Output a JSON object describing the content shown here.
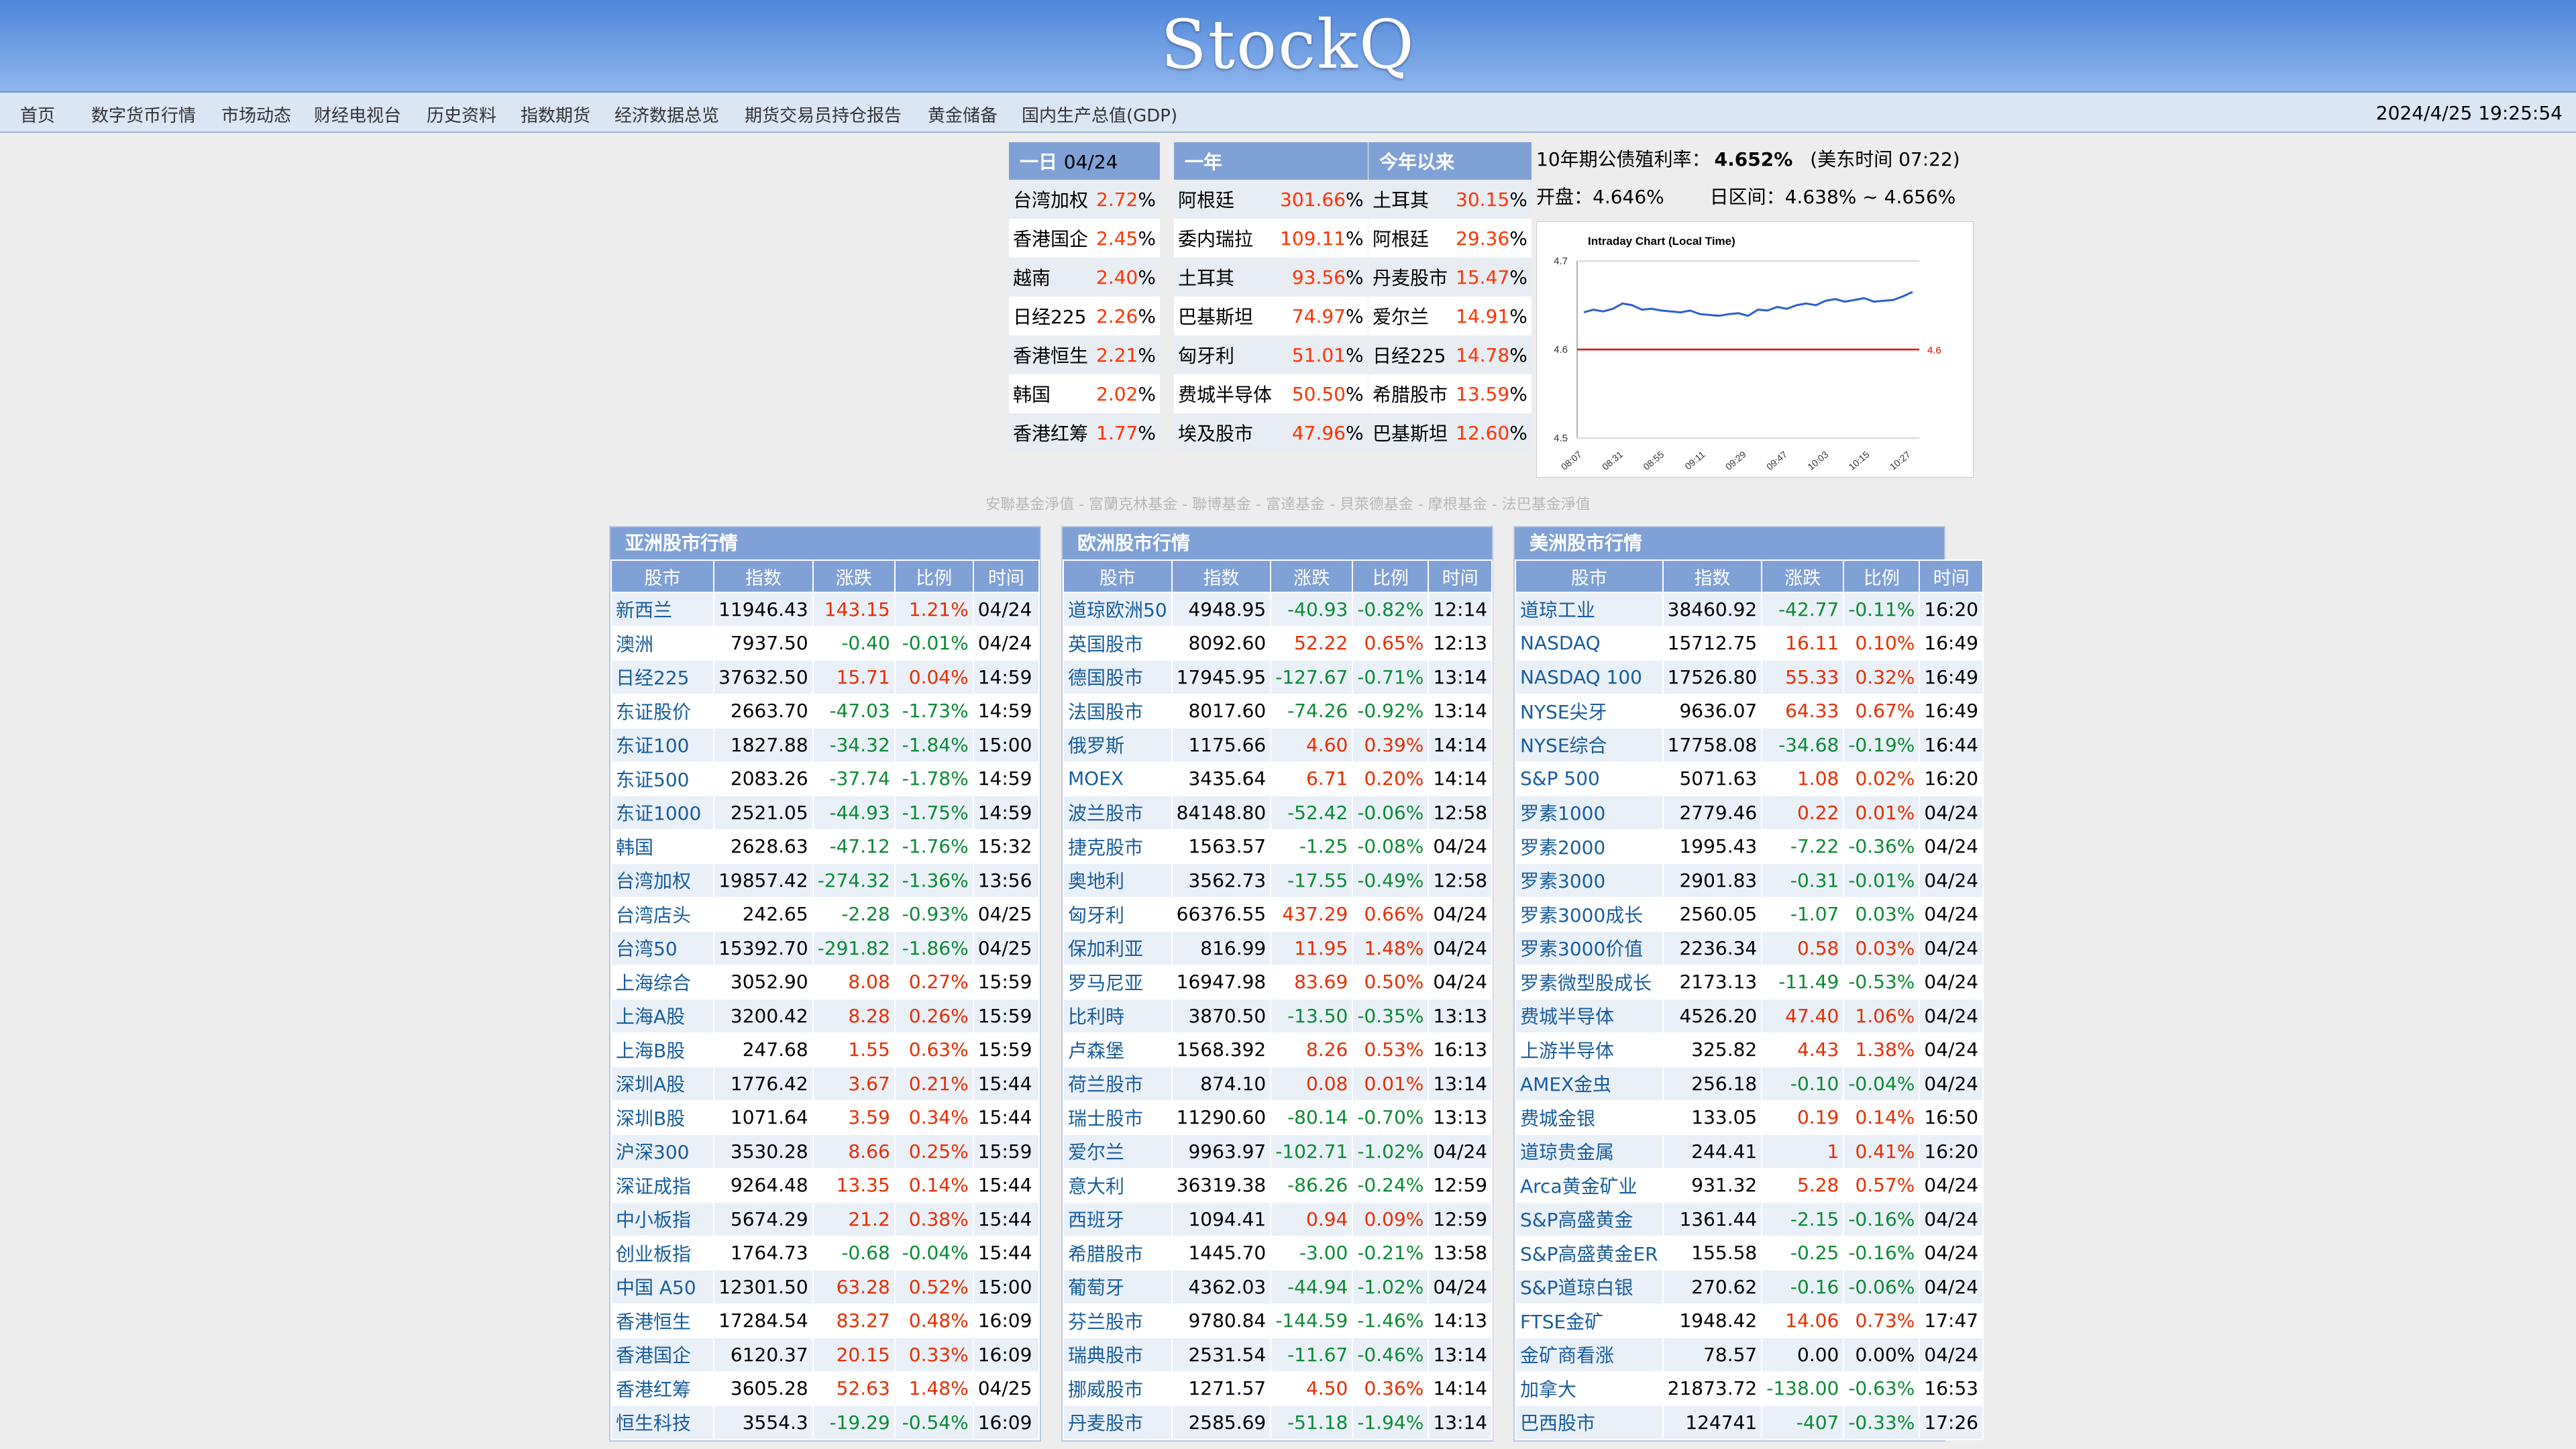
{
  "brand": "StockQ",
  "nav": [
    "首页",
    "数字货币行情",
    "市场动态",
    "财经电视台",
    "历史资料",
    "指数期货",
    "经济数据总览",
    "期货交易员持仓报告",
    "黄金储备",
    "国内生产总值(GDP)"
  ],
  "datetime": "2024/4/25  19:25:54",
  "top": {
    "day": {
      "title": "一日 ",
      "date": "04/24",
      "rows": [
        [
          "台湾加权",
          "2.72"
        ],
        [
          "香港国企",
          "2.45"
        ],
        [
          "越南",
          "2.40"
        ],
        [
          "日经225",
          "2.26"
        ],
        [
          "香港恒生",
          "2.21"
        ],
        [
          "韩国",
          "2.02"
        ],
        [
          "香港红筹",
          "1.77"
        ]
      ]
    },
    "year": {
      "title": "一年",
      "rows": [
        [
          "阿根廷",
          "301.66"
        ],
        [
          "委内瑞拉",
          "109.11"
        ],
        [
          "土耳其",
          "93.56"
        ],
        [
          "巴基斯坦",
          "74.97"
        ],
        [
          "匈牙利",
          "51.01"
        ],
        [
          "费城半导体",
          "50.50"
        ],
        [
          "埃及股市",
          "47.96"
        ]
      ]
    },
    "ytd": {
      "title": "今年以来",
      "rows": [
        [
          "土耳其",
          "30.15"
        ],
        [
          "阿根廷",
          "29.36"
        ],
        [
          "丹麦股市",
          "15.47"
        ],
        [
          "爱尔兰",
          "14.91"
        ],
        [
          "日经225",
          "14.78"
        ],
        [
          "希腊股市",
          "13.59"
        ],
        [
          "巴基斯坦",
          "12.60"
        ]
      ]
    }
  },
  "bond": {
    "label": "10年期公债殖利率：",
    "value": "4.652%",
    "time": "(美东时间 07:22)",
    "open_label": "开盘：",
    "open": "4.646%",
    "range_label": "日区间：",
    "range": "4.638% ~ 4.656%"
  },
  "chart_data": {
    "type": "line",
    "title": "Intraday Chart (Local Time)",
    "x": [
      "08:07",
      "08:31",
      "08:55",
      "09:11",
      "09:29",
      "09:47",
      "10:03",
      "10:15",
      "10:27"
    ],
    "ylim": [
      4.5,
      4.7
    ],
    "yticks": [
      "4.5",
      "4.6",
      "4.7"
    ],
    "reference": {
      "value": 4.6,
      "label": "4.6",
      "color": "#e60000"
    },
    "series": [
      {
        "color": "#2b5fce",
        "values": [
          4.642,
          4.645,
          4.643,
          4.646,
          4.652,
          4.65,
          4.645,
          4.646,
          4.644,
          4.643,
          4.642,
          4.644,
          4.64,
          4.639,
          4.638,
          4.64,
          4.641,
          4.638,
          4.645,
          4.644,
          4.648,
          4.646,
          4.65,
          4.652,
          4.65,
          4.655,
          4.657,
          4.654,
          4.656,
          4.658,
          4.654,
          4.655,
          4.656,
          4.66,
          4.665
        ]
      }
    ]
  },
  "funds_text": "安聯基金淨值 - 富蘭克林基金 - 聯博基金 - 富達基金 - 貝萊德基金 - 摩根基金 - 法巴基金淨值",
  "columns": [
    "股市",
    "指数",
    "涨跌",
    "比例",
    "时间"
  ],
  "asia": {
    "title": "亚洲股市行情",
    "rows": [
      [
        "新西兰",
        "11946.43",
        "143.15",
        "1.21%",
        "04/24"
      ],
      [
        "澳洲",
        "7937.50",
        "-0.40",
        "-0.01%",
        "04/24"
      ],
      [
        "日经225",
        "37632.50",
        "15.71",
        "0.04%",
        "14:59"
      ],
      [
        "东证股价",
        "2663.70",
        "-47.03",
        "-1.73%",
        "14:59"
      ],
      [
        "东证100",
        "1827.88",
        "-34.32",
        "-1.84%",
        "15:00"
      ],
      [
        "东证500",
        "2083.26",
        "-37.74",
        "-1.78%",
        "14:59"
      ],
      [
        "东证1000",
        "2521.05",
        "-44.93",
        "-1.75%",
        "14:59"
      ],
      [
        "韩国",
        "2628.63",
        "-47.12",
        "-1.76%",
        "15:32"
      ],
      [
        "台湾加权",
        "19857.42",
        "-274.32",
        "-1.36%",
        "13:56"
      ],
      [
        "台湾店头",
        "242.65",
        "-2.28",
        "-0.93%",
        "04/25"
      ],
      [
        "台湾50",
        "15392.70",
        "-291.82",
        "-1.86%",
        "04/25"
      ],
      [
        "上海综合",
        "3052.90",
        "8.08",
        "0.27%",
        "15:59"
      ],
      [
        "上海A股",
        "3200.42",
        "8.28",
        "0.26%",
        "15:59"
      ],
      [
        "上海B股",
        "247.68",
        "1.55",
        "0.63%",
        "15:59"
      ],
      [
        "深圳A股",
        "1776.42",
        "3.67",
        "0.21%",
        "15:44"
      ],
      [
        "深圳B股",
        "1071.64",
        "3.59",
        "0.34%",
        "15:44"
      ],
      [
        "沪深300",
        "3530.28",
        "8.66",
        "0.25%",
        "15:59"
      ],
      [
        "深证成指",
        "9264.48",
        "13.35",
        "0.14%",
        "15:44"
      ],
      [
        "中小板指",
        "5674.29",
        "21.2",
        "0.38%",
        "15:44"
      ],
      [
        "创业板指",
        "1764.73",
        "-0.68",
        "-0.04%",
        "15:44"
      ],
      [
        "中国 A50",
        "12301.50",
        "63.28",
        "0.52%",
        "15:00"
      ],
      [
        "香港恒生",
        "17284.54",
        "83.27",
        "0.48%",
        "16:09"
      ],
      [
        "香港国企",
        "6120.37",
        "20.15",
        "0.33%",
        "16:09"
      ],
      [
        "香港红筹",
        "3605.28",
        "52.63",
        "1.48%",
        "04/25"
      ],
      [
        "恒生科技",
        "3554.3",
        "-19.29",
        "-0.54%",
        "16:09"
      ]
    ]
  },
  "europe": {
    "title": "欧洲股市行情",
    "rows": [
      [
        "道琼欧洲50",
        "4948.95",
        "-40.93",
        "-0.82%",
        "12:14"
      ],
      [
        "英国股市",
        "8092.60",
        "52.22",
        "0.65%",
        "12:13"
      ],
      [
        "德国股市",
        "17945.95",
        "-127.67",
        "-0.71%",
        "13:14"
      ],
      [
        "法国股市",
        "8017.60",
        "-74.26",
        "-0.92%",
        "13:14"
      ],
      [
        "俄罗斯",
        "1175.66",
        "4.60",
        "0.39%",
        "14:14"
      ],
      [
        "MOEX",
        "3435.64",
        "6.71",
        "0.20%",
        "14:14"
      ],
      [
        "波兰股市",
        "84148.80",
        "-52.42",
        "-0.06%",
        "12:58"
      ],
      [
        "捷克股市",
        "1563.57",
        "-1.25",
        "-0.08%",
        "04/24"
      ],
      [
        "奥地利",
        "3562.73",
        "-17.55",
        "-0.49%",
        "12:58"
      ],
      [
        "匈牙利",
        "66376.55",
        "437.29",
        "0.66%",
        "04/24"
      ],
      [
        "保加利亚",
        "816.99",
        "11.95",
        "1.48%",
        "04/24"
      ],
      [
        "罗马尼亚",
        "16947.98",
        "83.69",
        "0.50%",
        "04/24"
      ],
      [
        "比利時",
        "3870.50",
        "-13.50",
        "-0.35%",
        "13:13"
      ],
      [
        "卢森堡",
        "1568.392",
        "8.26",
        "0.53%",
        "16:13"
      ],
      [
        "荷兰股市",
        "874.10",
        "0.08",
        "0.01%",
        "13:14"
      ],
      [
        "瑞士股市",
        "11290.60",
        "-80.14",
        "-0.70%",
        "13:13"
      ],
      [
        "爱尔兰",
        "9963.97",
        "-102.71",
        "-1.02%",
        "04/24"
      ],
      [
        "意大利",
        "36319.38",
        "-86.26",
        "-0.24%",
        "12:59"
      ],
      [
        "西班牙",
        "1094.41",
        "0.94",
        "0.09%",
        "12:59"
      ],
      [
        "希腊股市",
        "1445.70",
        "-3.00",
        "-0.21%",
        "13:58"
      ],
      [
        "葡萄牙",
        "4362.03",
        "-44.94",
        "-1.02%",
        "04/24"
      ],
      [
        "芬兰股市",
        "9780.84",
        "-144.59",
        "-1.46%",
        "14:13"
      ],
      [
        "瑞典股市",
        "2531.54",
        "-11.67",
        "-0.46%",
        "13:14"
      ],
      [
        "挪威股市",
        "1271.57",
        "4.50",
        "0.36%",
        "14:14"
      ],
      [
        "丹麦股市",
        "2585.69",
        "-51.18",
        "-1.94%",
        "13:14"
      ]
    ]
  },
  "america": {
    "title": "美洲股市行情",
    "rows": [
      [
        "道琼工业",
        "38460.92",
        "-42.77",
        "-0.11%",
        "16:20"
      ],
      [
        "NASDAQ",
        "15712.75",
        "16.11",
        "0.10%",
        "16:49"
      ],
      [
        "NASDAQ 100",
        "17526.80",
        "55.33",
        "0.32%",
        "16:49"
      ],
      [
        "NYSE尖牙",
        "9636.07",
        "64.33",
        "0.67%",
        "16:49"
      ],
      [
        "NYSE综合",
        "17758.08",
        "-34.68",
        "-0.19%",
        "16:44"
      ],
      [
        "S&P 500",
        "5071.63",
        "1.08",
        "0.02%",
        "16:20"
      ],
      [
        "罗素1000",
        "2779.46",
        "0.22",
        "0.01%",
        "04/24"
      ],
      [
        "罗素2000",
        "1995.43",
        "-7.22",
        "-0.36%",
        "04/24"
      ],
      [
        "罗素3000",
        "2901.83",
        "-0.31",
        "-0.01%",
        "04/24"
      ],
      [
        "罗素3000成长",
        "2560.05",
        "-1.07",
        "0.03%",
        "04/24"
      ],
      [
        "罗素3000价值",
        "2236.34",
        "0.58",
        "0.03%",
        "04/24"
      ],
      [
        "罗素微型股成长",
        "2173.13",
        "-11.49",
        "-0.53%",
        "04/24"
      ],
      [
        "费城半导体",
        "4526.20",
        "47.40",
        "1.06%",
        "04/24"
      ],
      [
        "上游半导体",
        "325.82",
        "4.43",
        "1.38%",
        "04/24"
      ],
      [
        "AMEX金虫",
        "256.18",
        "-0.10",
        "-0.04%",
        "04/24"
      ],
      [
        "费城金银",
        "133.05",
        "0.19",
        "0.14%",
        "16:50"
      ],
      [
        "道琼贵金属",
        "244.41",
        "1",
        "0.41%",
        "16:20"
      ],
      [
        "Arca黄金矿业",
        "931.32",
        "5.28",
        "0.57%",
        "04/24"
      ],
      [
        "S&P高盛黄金",
        "1361.44",
        "-2.15",
        "-0.16%",
        "04/24"
      ],
      [
        "S&P高盛黄金ER",
        "155.58",
        "-0.25",
        "-0.16%",
        "04/24"
      ],
      [
        "S&P道琼白银",
        "270.62",
        "-0.16",
        "-0.06%",
        "04/24"
      ],
      [
        "FTSE金矿",
        "1948.42",
        "14.06",
        "0.73%",
        "17:47"
      ],
      [
        "金矿商看涨",
        "78.57",
        "0.00",
        "0.00%",
        "04/24"
      ],
      [
        "加拿大",
        "21873.72",
        "-138.00",
        "-0.63%",
        "16:53"
      ],
      [
        "巴西股市",
        "124741",
        "-407",
        "-0.33%",
        "17:26"
      ]
    ]
  }
}
